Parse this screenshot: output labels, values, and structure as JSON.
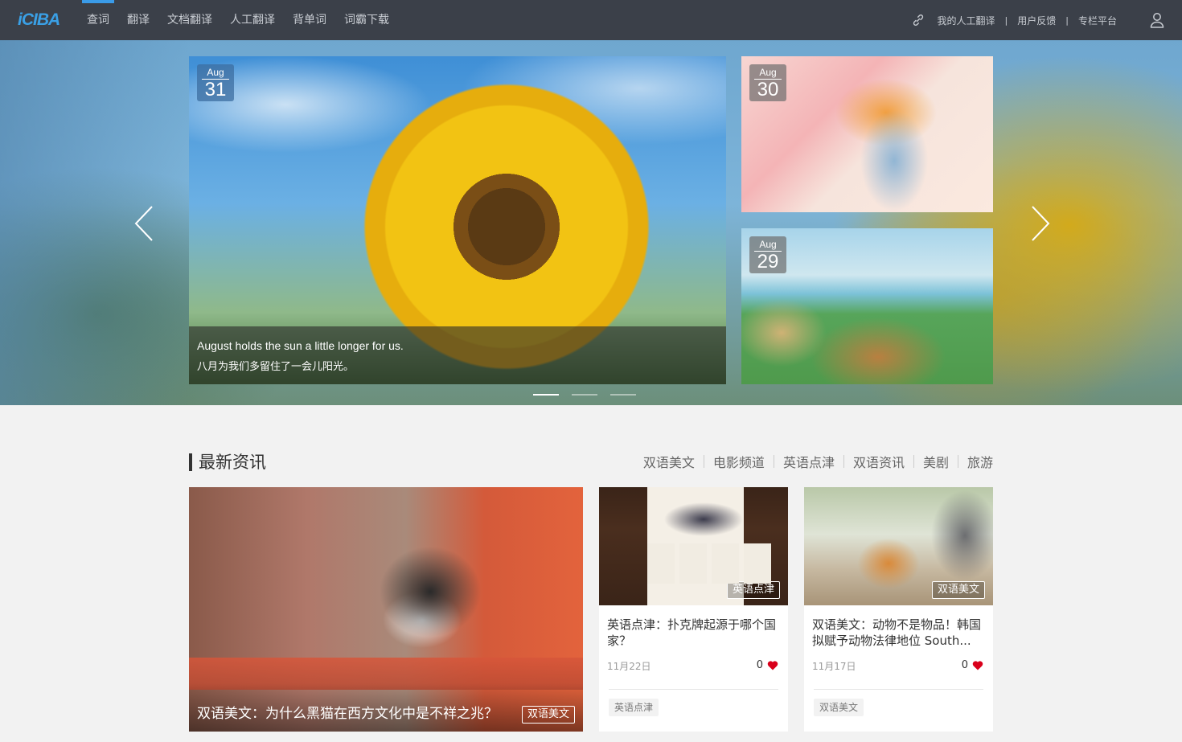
{
  "header": {
    "logo": "iCIBA",
    "nav": [
      "查词",
      "翻译",
      "文档翻译",
      "人工翻译",
      "背单词",
      "词霸下载"
    ],
    "active_nav": 0,
    "links": [
      "我的人工翻译",
      "用户反馈",
      "专栏平台"
    ],
    "separator": "|",
    "icons": {
      "link": "link-icon",
      "user": "user-icon"
    }
  },
  "banner": {
    "feature": {
      "month": "Aug",
      "day": "31",
      "caption_en": "August holds the sun a little longer for us.",
      "caption_cn": "八月为我们多留住了一会儿阳光。"
    },
    "side": [
      {
        "month": "Aug",
        "day": "30"
      },
      {
        "month": "Aug",
        "day": "29"
      }
    ],
    "dots": 3,
    "active_dot": 0
  },
  "news": {
    "title": "最新资讯",
    "categories": [
      "双语美文",
      "电影频道",
      "英语点津",
      "双语资讯",
      "美剧",
      "旅游"
    ],
    "big": {
      "title": "双语美文：为什么黑猫在西方文化中是不祥之兆？",
      "tag": "双语美文"
    },
    "cards": [
      {
        "title": "英语点津：扑克牌起源于哪个国家？",
        "tag": "英语点津",
        "date": "11月22日",
        "likes": "0",
        "category": "英语点津"
      },
      {
        "title": "双语美文：动物不是物品！韩国拟赋予动物法律地位 South...",
        "tag": "双语美文",
        "date": "11月17日",
        "likes": "0",
        "category": "双语美文"
      }
    ]
  },
  "colors": {
    "topbar": "#3b4049",
    "accent": "#3a9be8",
    "heart": "#d9001b"
  }
}
